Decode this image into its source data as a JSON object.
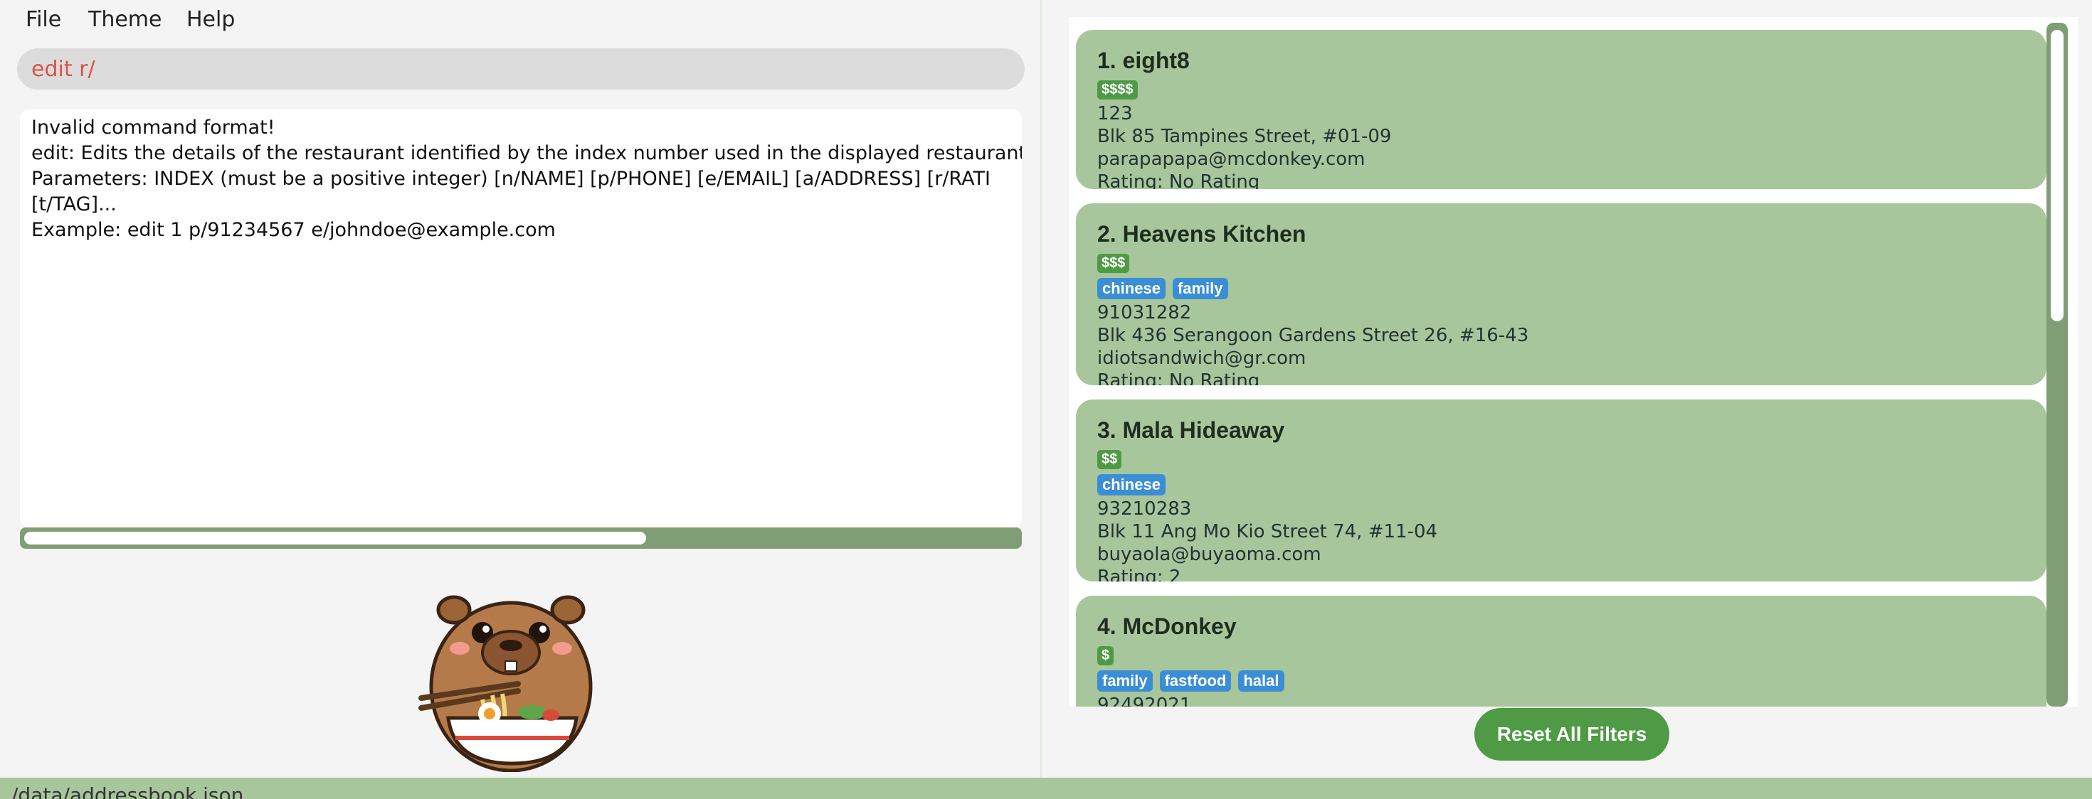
{
  "menu": {
    "file": "File",
    "theme": "Theme",
    "help": "Help"
  },
  "command": {
    "value": "edit r/"
  },
  "result": {
    "lines": [
      "Invalid command format!",
      "edit: Edits the details of the restaurant identified by the index number used in the displayed restaurant",
      "Parameters: INDEX (must be a positive integer) [n/NAME] [p/PHONE] [e/EMAIL] [a/ADDRESS] [r/RATI",
      "[t/TAG]...",
      "Example: edit 1 p/91234567 e/johndoe@example.com"
    ]
  },
  "restaurants": [
    {
      "name": "1. eight8",
      "price": "$$$$",
      "tags": [],
      "phone": "123",
      "address": "Blk 85 Tampines Street, #01-09",
      "email": "parapapapa@mcdonkey.com",
      "rating": "Rating: No Rating"
    },
    {
      "name": "2. Heavens Kitchen",
      "price": "$$$",
      "tags": [
        "chinese",
        "family"
      ],
      "phone": "91031282",
      "address": "Blk 436 Serangoon Gardens Street 26, #16-43",
      "email": "idiotsandwich@gr.com",
      "rating": "Rating: No Rating"
    },
    {
      "name": "3. Mala Hideaway",
      "price": "$$",
      "tags": [
        "chinese"
      ],
      "phone": "93210283",
      "address": "Blk 11 Ang Mo Kio Street 74, #11-04",
      "email": "buyaola@buyaoma.com",
      "rating": "Rating: 2"
    },
    {
      "name": "4. McDonkey",
      "price": "$",
      "tags": [
        "family",
        "fastfood",
        "halal"
      ],
      "phone": "92492021"
    }
  ],
  "reset_button": "Reset All Filters",
  "status": {
    "path": "/data/addressbook.json"
  },
  "colors": {
    "card": "#a8c69c",
    "price_badge": "#4f9a45",
    "tag": "#3a8ed6",
    "error_text": "#d9534f"
  },
  "icons": {
    "mascot": "capybara-ramen-icon"
  }
}
